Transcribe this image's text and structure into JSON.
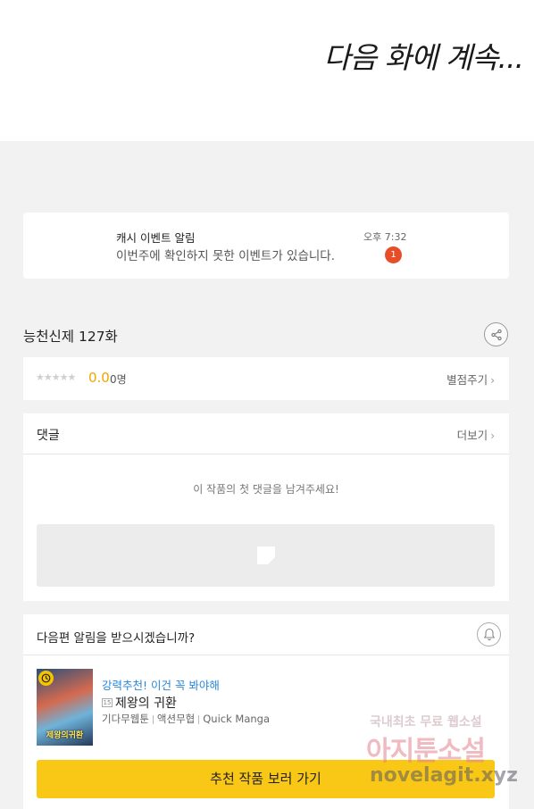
{
  "comic": {
    "end_text": "다음 화에 계속..."
  },
  "notification": {
    "title": "캐시 이벤트 알림",
    "body": "이번주에 확인하지 못한 이벤트가 있습니다.",
    "time": "오후 7:32",
    "badge_count": "1"
  },
  "episode": {
    "title": "능천신제 127화"
  },
  "rating": {
    "stars": "★★★★★",
    "score": "0.0",
    "count": "0명",
    "rate_label": "별점주기"
  },
  "comments": {
    "header": "댓글",
    "more_label": "더보기",
    "empty_text": "이 작품의 첫 댓글을 남겨주세요!"
  },
  "next_episode": {
    "question": "다음편 알림을 받으시겠습니까?"
  },
  "recommendation": {
    "tag": "강력추천! 이건 꼭 봐야해",
    "age_badge": "15",
    "title": "제왕의 귀환",
    "meta": [
      "기다무웹툰",
      "액션무협",
      "Quick Manga"
    ],
    "thumbnail_text": "제왕의귀환",
    "cta_label": "추천 작품 보러 가기"
  },
  "watermark": {
    "line1": "국내최초 무료 웹소설",
    "line2": "아지툰소설",
    "line3": "novelagit.xyz"
  },
  "colors": {
    "accent_yellow": "#f9c716",
    "score_orange": "#f0a500",
    "badge_red": "#e84d2a",
    "link_blue": "#2a86d6"
  }
}
